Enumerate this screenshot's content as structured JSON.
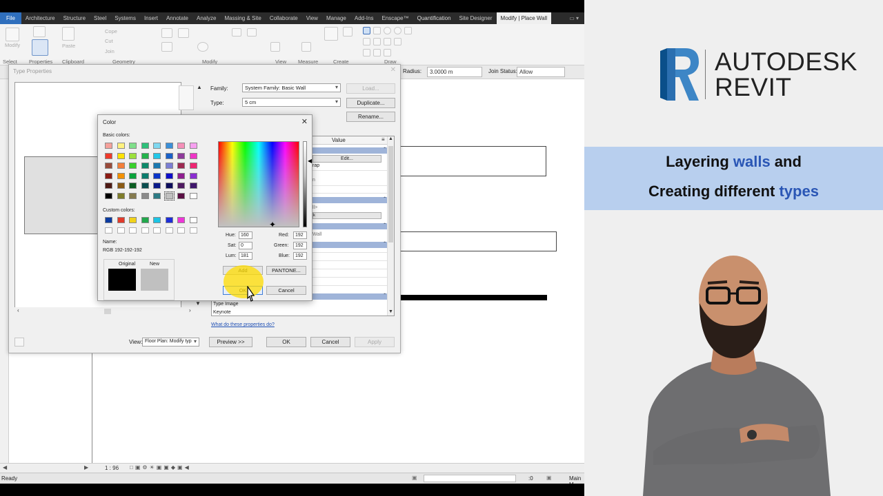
{
  "ribbon": {
    "tabs": [
      "File",
      "Architecture",
      "Structure",
      "Steel",
      "Systems",
      "Insert",
      "Annotate",
      "Analyze",
      "Massing & Site",
      "Collaborate",
      "View",
      "Manage",
      "Add-Ins",
      "Enscape™",
      "Quantification",
      "Site Designer",
      "Modify | Place Wall"
    ],
    "active_tab": "Modify | Place Wall",
    "panels": [
      "Select",
      "Properties",
      "Clipboard",
      "Geometry",
      "Modify",
      "View",
      "Measure",
      "Create",
      "Draw"
    ],
    "buttons": {
      "modify": "Modify",
      "paste": "Paste",
      "cope": "Cope",
      "cut": "Cut",
      "join": "Join"
    }
  },
  "options_bar": {
    "radius_label": "Radius:",
    "radius_value": "3.0000 m",
    "join_status_label": "Join Status:",
    "join_status_value": "Allow"
  },
  "type_properties": {
    "title": "Type Properties",
    "family_label": "Family:",
    "family_value": "System Family: Basic Wall",
    "type_label": "Type:",
    "type_value": "5 cm",
    "load_button": "Load...",
    "duplicate_button": "Duplicate...",
    "rename_button": "Rename...",
    "value_header": "Value",
    "edit_button": "Edit...",
    "partial_rows": [
      "rap",
      "n",
      "ll>",
      "k",
      "Wall"
    ],
    "visible_params": [
      "Type Image",
      "Keynote"
    ],
    "help_link": "What do these properties do?",
    "view_label": "View:",
    "view_value": "Floor Plan: Modify typ",
    "preview_button": "Preview >>",
    "ok_button": "OK",
    "cancel_button": "Cancel",
    "apply_button": "Apply"
  },
  "color_dialog": {
    "title": "Color",
    "basic_colors_label": "Basic colors:",
    "basic_colors": [
      [
        "#f4a09a",
        "#fff27f",
        "#7fdf8a",
        "#2ec07a",
        "#7fd8f0",
        "#3b8fd8",
        "#f48fb8",
        "#f7a0f0"
      ],
      [
        "#ee3a2b",
        "#ffe200",
        "#9be03c",
        "#23b34c",
        "#22c7e8",
        "#1a60c8",
        "#8e3a9a",
        "#ee35c5"
      ],
      [
        "#9a4b3b",
        "#f37f3a",
        "#39d02c",
        "#0d8a6a",
        "#1a79b0",
        "#7b7ed4",
        "#9d2a52",
        "#ee2673"
      ],
      [
        "#8b1b13",
        "#f39100",
        "#0aa33b",
        "#0b7c6d",
        "#0a36c9",
        "#0d0ec9",
        "#8f1d8f",
        "#8b2ed1"
      ],
      [
        "#4e1a14",
        "#8a5a14",
        "#0b5e22",
        "#0b4e4f",
        "#0a1b8a",
        "#0c0c5c",
        "#4f1a60",
        "#40176c"
      ],
      [
        "#000000",
        "#7f7d2b",
        "#847a4e",
        "#8a8a8a",
        "#2c7a84",
        "#c0c0c0",
        "#5a0f44",
        "#ffffff"
      ]
    ],
    "selected_basic": [
      5,
      5
    ],
    "custom_colors_label": "Custom colors:",
    "custom_colors": [
      "#0a3aa0",
      "#e23a2b",
      "#f1d21a",
      "#21a84c",
      "#1cc4e4",
      "#1d2ed8",
      "#ee35d8",
      "#ffffff"
    ],
    "name_label": "Name:",
    "name_value": "RGB 192-192-192",
    "original_label": "Original",
    "new_label": "New",
    "original_color": "#000000",
    "new_color": "#c0c0c0",
    "hue_label": "Hue:",
    "hue_value": "160",
    "sat_label": "Sat:",
    "sat_value": "0",
    "lum_label": "Lum:",
    "lum_value": "181",
    "red_label": "Red:",
    "red_value": "192",
    "green_label": "Green:",
    "green_value": "192",
    "blue_label": "Blue:",
    "blue_value": "192",
    "add_button": "Add",
    "pantone_button": "PANTONE...",
    "ok_button": "OK",
    "cancel_button": "Cancel"
  },
  "view_controls": {
    "scale": "1 : 96"
  },
  "status": {
    "text": "Ready",
    "workset": ":0",
    "model": "Main M"
  },
  "brand": {
    "line1": "AUTODESK",
    "line2": "REVIT",
    "logo_letter": "R"
  },
  "caption": {
    "line1_a": "Layering ",
    "line1_b": "walls",
    "line1_c": " and",
    "line2_a": "Creating different ",
    "line2_b": "types"
  }
}
